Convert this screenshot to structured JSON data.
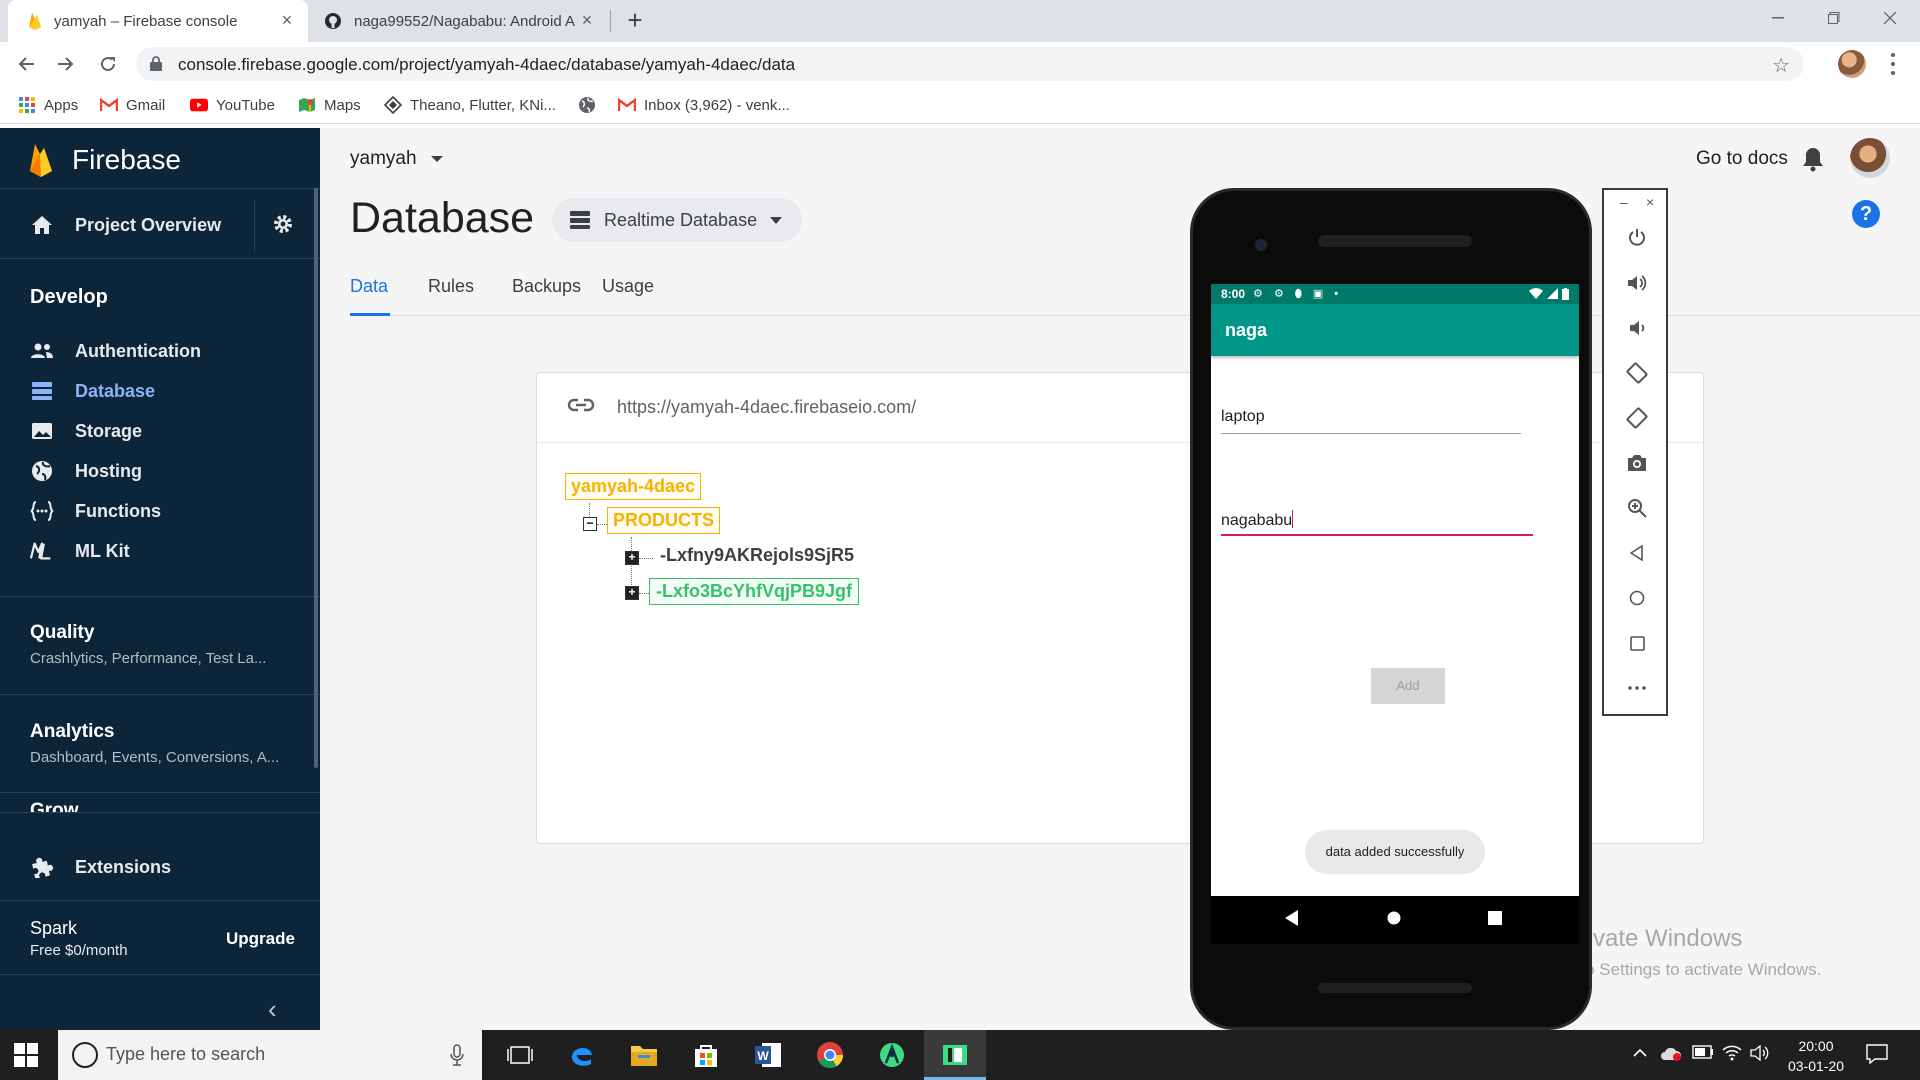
{
  "browser": {
    "tabs": [
      {
        "title": "yamyah – Firebase console",
        "active": true
      },
      {
        "title": "naga99552/Nagababu: Android A",
        "active": false
      }
    ],
    "url": "console.firebase.google.com/project/yamyah-4daec/database/yamyah-4daec/data",
    "bookmarks": [
      {
        "label": "Apps",
        "icon": "apps-grid-icon"
      },
      {
        "label": "Gmail",
        "icon": "gmail-icon"
      },
      {
        "label": "YouTube",
        "icon": "youtube-icon"
      },
      {
        "label": "Maps",
        "icon": "maps-icon"
      },
      {
        "label": "Theano, Flutter, KNi...",
        "icon": "diamond-icon"
      },
      {
        "label": "",
        "icon": "globe-icon"
      },
      {
        "label": "Inbox (3,962) - venk...",
        "icon": "gmail-icon"
      }
    ]
  },
  "sidebar": {
    "brand": "Firebase",
    "overview": "Project Overview",
    "develop_header": "Develop",
    "develop_items": [
      {
        "label": "Authentication",
        "icon": "people-icon",
        "active": false
      },
      {
        "label": "Database",
        "icon": "database-icon",
        "active": true
      },
      {
        "label": "Storage",
        "icon": "image-icon",
        "active": false
      },
      {
        "label": "Hosting",
        "icon": "globe-icon",
        "active": false
      },
      {
        "label": "Functions",
        "icon": "functions-icon",
        "active": false
      },
      {
        "label": "ML Kit",
        "icon": "ml-kit-icon",
        "active": false
      }
    ],
    "quality": {
      "title": "Quality",
      "subtitle": "Crashlytics, Performance, Test La..."
    },
    "analytics": {
      "title": "Analytics",
      "subtitle": "Dashboard, Events, Conversions, A..."
    },
    "grow": {
      "title": "Grow"
    },
    "extensions": "Extensions",
    "plan": {
      "name": "Spark",
      "price": "Free $0/month",
      "upgrade": "Upgrade"
    }
  },
  "header": {
    "project": "yamyah",
    "go_to_docs": "Go to docs",
    "help": "?"
  },
  "page": {
    "title": "Database",
    "db_select": "Realtime Database",
    "tabs": [
      "Data",
      "Rules",
      "Backups",
      "Usage"
    ],
    "active_tab": "Data"
  },
  "db": {
    "url": "https://yamyah-4daec.firebaseio.com/",
    "root": "yamyah-4daec",
    "child": "PRODUCTS",
    "keys": [
      "-Lxfny9AKRejols9SjR5",
      "-Lxfo3BcYhfVqjPB9Jgf"
    ]
  },
  "watermark": {
    "line1": "Activate Windows",
    "line2": "Go to Settings to activate Windows."
  },
  "phone": {
    "time": "8:00",
    "app_title": "naga",
    "field1_value": "laptop",
    "field2_value": "nagababu",
    "add_button": "Add",
    "toast": "data added successfully",
    "colors": {
      "status_bar": "#00796b",
      "app_bar": "#009688",
      "accent": "#d81b60"
    }
  },
  "emulator_controls": [
    "power-icon",
    "volume-up-icon",
    "volume-down-icon",
    "rotate-left-icon",
    "rotate-right-icon",
    "camera-icon",
    "zoom-icon",
    "back-icon",
    "home-icon",
    "overview-icon",
    "more-icon"
  ],
  "taskbar": {
    "search_placeholder": "Type here to search",
    "time": "20:00",
    "date": "03-01-20"
  }
}
